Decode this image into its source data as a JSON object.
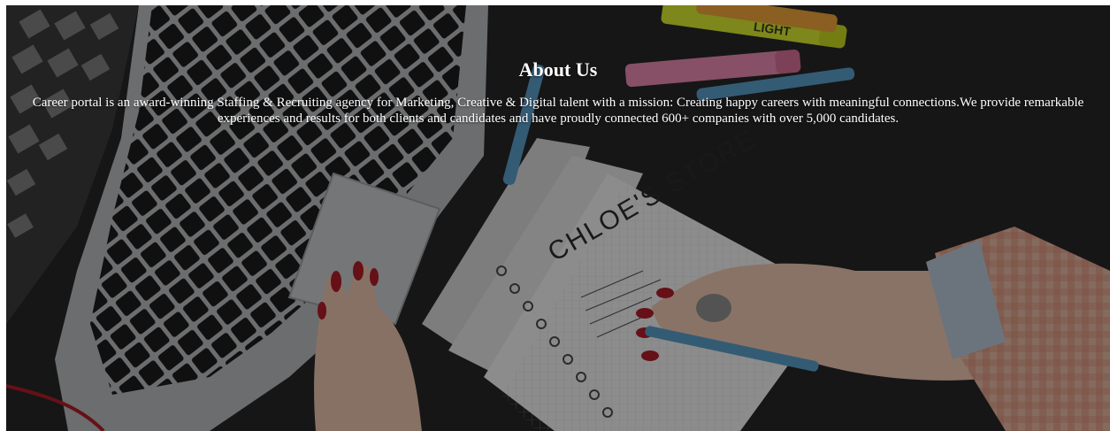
{
  "about": {
    "title": "About Us",
    "description": "Career portal is an award-winning Staffing & Recruiting agency for Marketing, Creative & Digital talent with a mission: Creating happy careers with meaningful connections.We provide remarkable experiences and results for both clients and candidates and have proudly connected 600+ companies with over 5,000 candidates."
  },
  "background_image": {
    "notebook_text": "CHLOE'S STORE",
    "marker_text": "LIGHT"
  },
  "colors": {
    "overlay": "#000000",
    "text": "#ffffff",
    "nail_polish": "#b01c28",
    "marker_yellow": "#d8e830",
    "marker_pink": "#e98ab0",
    "pen_blue": "#5b9dc9"
  }
}
